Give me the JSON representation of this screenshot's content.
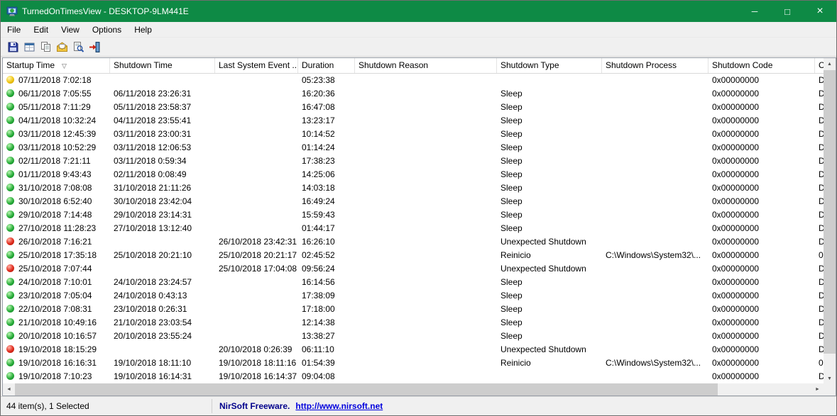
{
  "window": {
    "title": "TurnedOnTimesView -  DESKTOP-9LM441E"
  },
  "icons": {
    "minimize": "─",
    "maximize": "□",
    "close": "×",
    "sort_desc": "▽",
    "scroll_up": "▲",
    "scroll_down": "▼",
    "scroll_left": "◄",
    "scroll_right": "►"
  },
  "menu": {
    "items": [
      "File",
      "Edit",
      "View",
      "Options",
      "Help"
    ]
  },
  "toolbar": {
    "icons": [
      "save-icon",
      "export-icon",
      "copy-icon",
      "properties-icon",
      "find-icon",
      "exit-icon"
    ]
  },
  "table": {
    "columns": [
      "Startup Time",
      "Shutdown Time",
      "Last System Event ...",
      "Duration",
      "Shutdown Reason",
      "Shutdown Type",
      "Shutdown Process",
      "Shutdown Code",
      "C..."
    ],
    "sorted_column": "Startup Time",
    "sort_order": "descending",
    "rows": [
      {
        "icon": "yellow",
        "cells": [
          "07/11/2018 7:02:18",
          "",
          "",
          "05:23:38",
          "",
          "",
          "",
          "0x00000000",
          "D"
        ]
      },
      {
        "icon": "green",
        "cells": [
          "06/11/2018 7:05:55",
          "06/11/2018 23:26:31",
          "",
          "16:20:36",
          "",
          "Sleep",
          "",
          "0x00000000",
          "D"
        ]
      },
      {
        "icon": "green",
        "cells": [
          "05/11/2018 7:11:29",
          "05/11/2018 23:58:37",
          "",
          "16:47:08",
          "",
          "Sleep",
          "",
          "0x00000000",
          "D"
        ]
      },
      {
        "icon": "green",
        "cells": [
          "04/11/2018 10:32:24",
          "04/11/2018 23:55:41",
          "",
          "13:23:17",
          "",
          "Sleep",
          "",
          "0x00000000",
          "D"
        ]
      },
      {
        "icon": "green",
        "cells": [
          "03/11/2018 12:45:39",
          "03/11/2018 23:00:31",
          "",
          "10:14:52",
          "",
          "Sleep",
          "",
          "0x00000000",
          "D"
        ]
      },
      {
        "icon": "green",
        "cells": [
          "03/11/2018 10:52:29",
          "03/11/2018 12:06:53",
          "",
          "01:14:24",
          "",
          "Sleep",
          "",
          "0x00000000",
          "D"
        ]
      },
      {
        "icon": "green",
        "cells": [
          "02/11/2018 7:21:11",
          "03/11/2018 0:59:34",
          "",
          "17:38:23",
          "",
          "Sleep",
          "",
          "0x00000000",
          "D"
        ]
      },
      {
        "icon": "green",
        "cells": [
          "01/11/2018 9:43:43",
          "02/11/2018 0:08:49",
          "",
          "14:25:06",
          "",
          "Sleep",
          "",
          "0x00000000",
          "D"
        ]
      },
      {
        "icon": "green",
        "cells": [
          "31/10/2018 7:08:08",
          "31/10/2018 21:11:26",
          "",
          "14:03:18",
          "",
          "Sleep",
          "",
          "0x00000000",
          "D"
        ]
      },
      {
        "icon": "green",
        "cells": [
          "30/10/2018 6:52:40",
          "30/10/2018 23:42:04",
          "",
          "16:49:24",
          "",
          "Sleep",
          "",
          "0x00000000",
          "D"
        ]
      },
      {
        "icon": "green",
        "cells": [
          "29/10/2018 7:14:48",
          "29/10/2018 23:14:31",
          "",
          "15:59:43",
          "",
          "Sleep",
          "",
          "0x00000000",
          "D"
        ]
      },
      {
        "icon": "green",
        "cells": [
          "27/10/2018 11:28:23",
          "27/10/2018 13:12:40",
          "",
          "01:44:17",
          "",
          "Sleep",
          "",
          "0x00000000",
          "D"
        ]
      },
      {
        "icon": "red",
        "cells": [
          "26/10/2018 7:16:21",
          "",
          "26/10/2018 23:42:31",
          "16:26:10",
          "",
          "Unexpected Shutdown",
          "",
          "0x00000000",
          "D"
        ]
      },
      {
        "icon": "green",
        "cells": [
          "25/10/2018 17:35:18",
          "25/10/2018 20:21:10",
          "25/10/2018 20:21:17",
          "02:45:52",
          "",
          "Reinicio",
          "C:\\Windows\\System32\\...",
          "0x00000000",
          "0"
        ]
      },
      {
        "icon": "red",
        "cells": [
          "25/10/2018 7:07:44",
          "",
          "25/10/2018 17:04:08",
          "09:56:24",
          "",
          "Unexpected Shutdown",
          "",
          "0x00000000",
          "D"
        ]
      },
      {
        "icon": "green",
        "cells": [
          "24/10/2018 7:10:01",
          "24/10/2018 23:24:57",
          "",
          "16:14:56",
          "",
          "Sleep",
          "",
          "0x00000000",
          "D"
        ]
      },
      {
        "icon": "green",
        "cells": [
          "23/10/2018 7:05:04",
          "24/10/2018 0:43:13",
          "",
          "17:38:09",
          "",
          "Sleep",
          "",
          "0x00000000",
          "D"
        ]
      },
      {
        "icon": "green",
        "cells": [
          "22/10/2018 7:08:31",
          "23/10/2018 0:26:31",
          "",
          "17:18:00",
          "",
          "Sleep",
          "",
          "0x00000000",
          "D"
        ]
      },
      {
        "icon": "green",
        "cells": [
          "21/10/2018 10:49:16",
          "21/10/2018 23:03:54",
          "",
          "12:14:38",
          "",
          "Sleep",
          "",
          "0x00000000",
          "D"
        ]
      },
      {
        "icon": "green",
        "cells": [
          "20/10/2018 10:16:57",
          "20/10/2018 23:55:24",
          "",
          "13:38:27",
          "",
          "Sleep",
          "",
          "0x00000000",
          "D"
        ]
      },
      {
        "icon": "red",
        "cells": [
          "19/10/2018 18:15:29",
          "",
          "20/10/2018 0:26:39",
          "06:11:10",
          "",
          "Unexpected Shutdown",
          "",
          "0x00000000",
          "D"
        ]
      },
      {
        "icon": "green",
        "cells": [
          "19/10/2018 16:16:31",
          "19/10/2018 18:11:10",
          "19/10/2018 18:11:16",
          "01:54:39",
          "",
          "Reinicio",
          "C:\\Windows\\System32\\...",
          "0x00000000",
          "0"
        ]
      },
      {
        "icon": "green",
        "cells": [
          "19/10/2018 7:10:23",
          "19/10/2018 16:14:31",
          "19/10/2018 16:14:37",
          "09:04:08",
          "",
          "",
          "",
          "0x00000000",
          "D"
        ]
      }
    ]
  },
  "statusbar": {
    "items_text": "44 item(s), 1 Selected",
    "freeware_text": "NirSoft Freeware.",
    "url": "http://www.nirsoft.net"
  },
  "colors": {
    "titlebar": "#0e8a45",
    "status_green": "#29ad3a",
    "status_red": "#e02b1d",
    "status_yellow": "#f0c514",
    "link_blue": "#0000dd"
  }
}
